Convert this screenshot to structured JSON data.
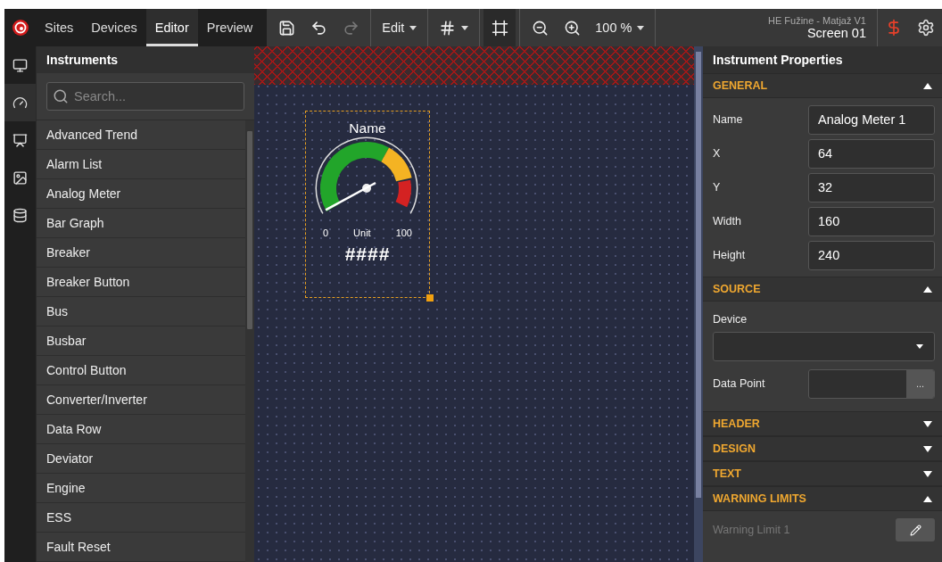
{
  "nav_tabs": [
    {
      "label": "Sites",
      "selected": false
    },
    {
      "label": "Devices",
      "selected": false
    },
    {
      "label": "Editor",
      "selected": true
    },
    {
      "label": "Preview",
      "selected": false
    }
  ],
  "tool_groups": [
    [
      {
        "kind": "save",
        "disabled": false
      },
      {
        "kind": "undo",
        "disabled": false
      },
      {
        "kind": "redo",
        "disabled": true
      }
    ],
    [
      {
        "kind": "menu",
        "label": "Edit"
      }
    ],
    [
      {
        "kind": "grid-menu"
      }
    ],
    [
      {
        "kind": "snap",
        "on": true
      }
    ],
    [
      {
        "kind": "zoom-out",
        "disabled": false
      },
      {
        "kind": "zoom-in",
        "disabled": false
      },
      {
        "kind": "menu",
        "label": "100 %"
      }
    ]
  ],
  "project": {
    "name": "HE Fužine - Matjaž V1",
    "screen": "Screen 01"
  },
  "rail": [
    {
      "kind": "monitor",
      "selected": false
    },
    {
      "kind": "instruments",
      "selected": true
    },
    {
      "kind": "display",
      "selected": false
    },
    {
      "kind": "image",
      "selected": false
    },
    {
      "kind": "database",
      "selected": false
    }
  ],
  "instruments": {
    "title": "Instruments",
    "search_placeholder": "Search...",
    "items": [
      "Advanced Trend",
      "Alarm List",
      "Analog Meter",
      "Bar Graph",
      "Breaker",
      "Breaker Button",
      "Bus",
      "Busbar",
      "Control Button",
      "Converter/Inverter",
      "Data Row",
      "Deviator",
      "Engine",
      "ESS",
      "Fault Reset"
    ]
  },
  "canvas": {
    "widget": {
      "title": "Name",
      "min": "0",
      "unit": "Unit",
      "max": "100",
      "value": "####",
      "selected": true
    }
  },
  "properties": {
    "title": "Instrument Properties",
    "sections": [
      {
        "title": "GENERAL",
        "expanded": true,
        "kind": "fields",
        "fields": [
          {
            "label": "Name",
            "value": "Analog Meter 1"
          },
          {
            "label": "X",
            "value": "64"
          },
          {
            "label": "Y",
            "value": "32"
          },
          {
            "label": "Width",
            "value": "160"
          },
          {
            "label": "Height",
            "value": "240"
          }
        ]
      },
      {
        "title": "SOURCE",
        "expanded": true,
        "kind": "source",
        "device_label": "Device",
        "data_point_label": "Data Point",
        "browse_button": "..."
      },
      {
        "title": "HEADER",
        "expanded": false
      },
      {
        "title": "DESIGN",
        "expanded": false
      },
      {
        "title": "TEXT",
        "expanded": false
      },
      {
        "title": "WARNING LIMITS",
        "expanded": true,
        "kind": "limits",
        "limits": [
          "Warning Limit 1"
        ]
      }
    ]
  }
}
